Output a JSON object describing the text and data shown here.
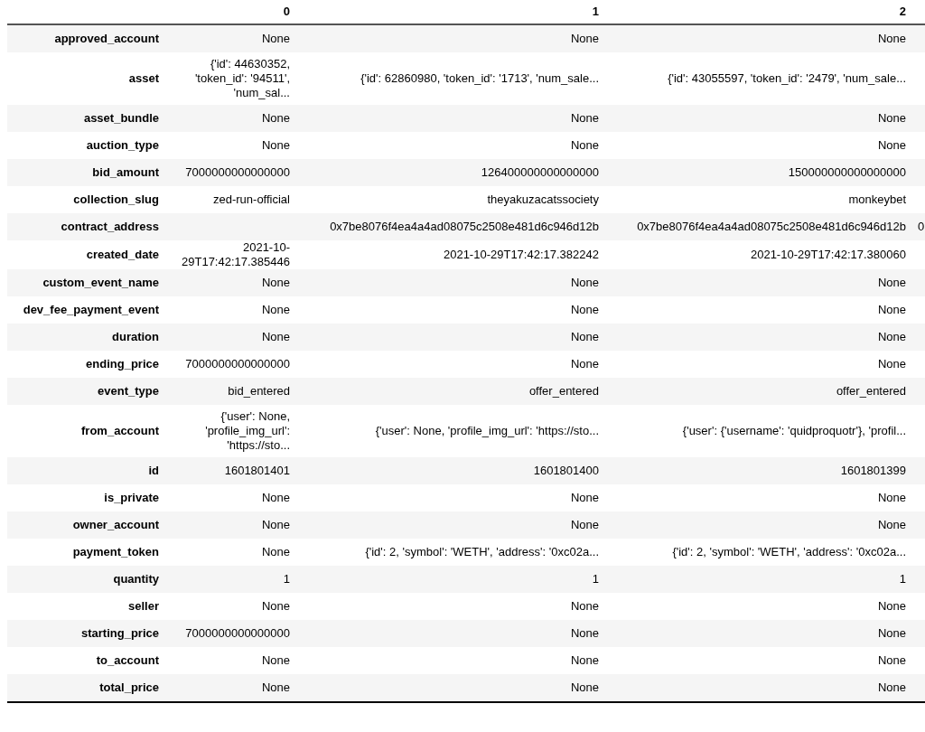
{
  "table": {
    "columns": [
      "0",
      "1",
      "2"
    ],
    "rows": [
      {
        "label": "approved_account",
        "cells": [
          "None",
          "None",
          "None"
        ]
      },
      {
        "label": "asset",
        "cells": [
          "{'id': 44630352, 'token_id': '94511', 'num_sal...",
          "{'id': 62860980, 'token_id': '1713', 'num_sale...",
          "{'id': 43055597, 'token_id': '2479', 'num_sale..."
        ]
      },
      {
        "label": "asset_bundle",
        "cells": [
          "None",
          "None",
          "None"
        ]
      },
      {
        "label": "auction_type",
        "cells": [
          "None",
          "None",
          "None"
        ]
      },
      {
        "label": "bid_amount",
        "cells": [
          "7000000000000000",
          "126400000000000000",
          "150000000000000000"
        ]
      },
      {
        "label": "collection_slug",
        "cells": [
          "zed-run-official",
          "theyakuzacatssociety",
          "monkeybet"
        ]
      },
      {
        "label": "contract_address",
        "cells": [
          null,
          "0x7be8076f4ea4a4ad08075c2508e481d6c946d12b",
          "0x7be8076f4ea4a4ad08075c2508e481d6c946d12b",
          "0"
        ]
      },
      {
        "label": "created_date",
        "cells": [
          "2021-10-29T17:42:17.385446",
          "2021-10-29T17:42:17.382242",
          "2021-10-29T17:42:17.380060"
        ]
      },
      {
        "label": "custom_event_name",
        "cells": [
          "None",
          "None",
          "None"
        ]
      },
      {
        "label": "dev_fee_payment_event",
        "cells": [
          "None",
          "None",
          "None"
        ]
      },
      {
        "label": "duration",
        "cells": [
          "None",
          "None",
          "None"
        ]
      },
      {
        "label": "ending_price",
        "cells": [
          "7000000000000000",
          "None",
          "None"
        ]
      },
      {
        "label": "event_type",
        "cells": [
          "bid_entered",
          "offer_entered",
          "offer_entered"
        ]
      },
      {
        "label": "from_account",
        "cells": [
          "{'user': None, 'profile_img_url': 'https://sto...",
          "{'user': None, 'profile_img_url': 'https://sto...",
          "{'user': {'username': 'quidproquotr'}, 'profil..."
        ]
      },
      {
        "label": "id",
        "cells": [
          "1601801401",
          "1601801400",
          "1601801399"
        ]
      },
      {
        "label": "is_private",
        "cells": [
          "None",
          "None",
          "None"
        ]
      },
      {
        "label": "owner_account",
        "cells": [
          "None",
          "None",
          "None"
        ]
      },
      {
        "label": "payment_token",
        "cells": [
          "None",
          "{'id': 2, 'symbol': 'WETH', 'address': '0xc02a...",
          "{'id': 2, 'symbol': 'WETH', 'address': '0xc02a..."
        ]
      },
      {
        "label": "quantity",
        "cells": [
          "1",
          "1",
          "1"
        ]
      },
      {
        "label": "seller",
        "cells": [
          "None",
          "None",
          "None"
        ]
      },
      {
        "label": "starting_price",
        "cells": [
          "7000000000000000",
          "None",
          "None"
        ]
      },
      {
        "label": "to_account",
        "cells": [
          "None",
          "None",
          "None"
        ]
      },
      {
        "label": "total_price",
        "cells": [
          "None",
          "None",
          "None"
        ]
      }
    ]
  }
}
